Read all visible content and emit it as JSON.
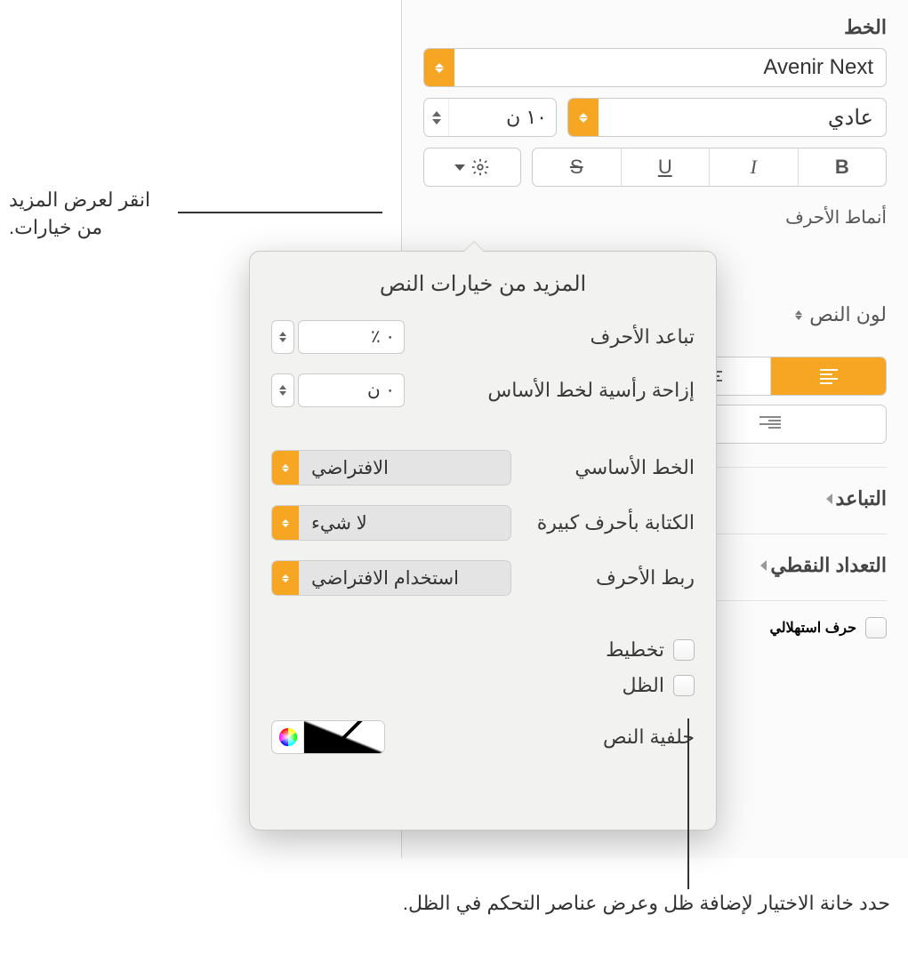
{
  "panel": {
    "title": "الخط",
    "font_family": "Avenir Next",
    "font_weight": "عادي",
    "font_size": "١٠ ن",
    "char_styles_label": "أنماط الأحرف",
    "text_color_label": "لون النص",
    "spacing_title": "التباعد",
    "bullets_title": "التعداد النقطي",
    "dropcap_label": "حرف استهلالي"
  },
  "format_btns": {
    "b": "B",
    "i": "I",
    "u": "U",
    "s": "S"
  },
  "callouts": {
    "gear": "انقر لعرض المزيد من خيارات.",
    "shadow": "حدد خانة الاختيار لإضافة ظل وعرض عناصر التحكم في الظل."
  },
  "popover": {
    "title": "المزيد من خيارات النص",
    "char_spacing_label": "تباعد الأحرف",
    "char_spacing_value": "٠ ٪",
    "baseline_shift_label": "إزاحة رأسية لخط الأساس",
    "baseline_shift_value": "٠ ن",
    "baseline_label": "الخط الأساسي",
    "baseline_value": "الافتراضي",
    "caps_label": "الكتابة بأحرف كبيرة",
    "caps_value": "لا شيء",
    "ligatures_label": "ربط الأحرف",
    "ligatures_value": "استخدام الافتراضي",
    "outline_label": "تخطيط",
    "shadow_label": "الظل",
    "text_bg_label": "خلفية النص"
  }
}
